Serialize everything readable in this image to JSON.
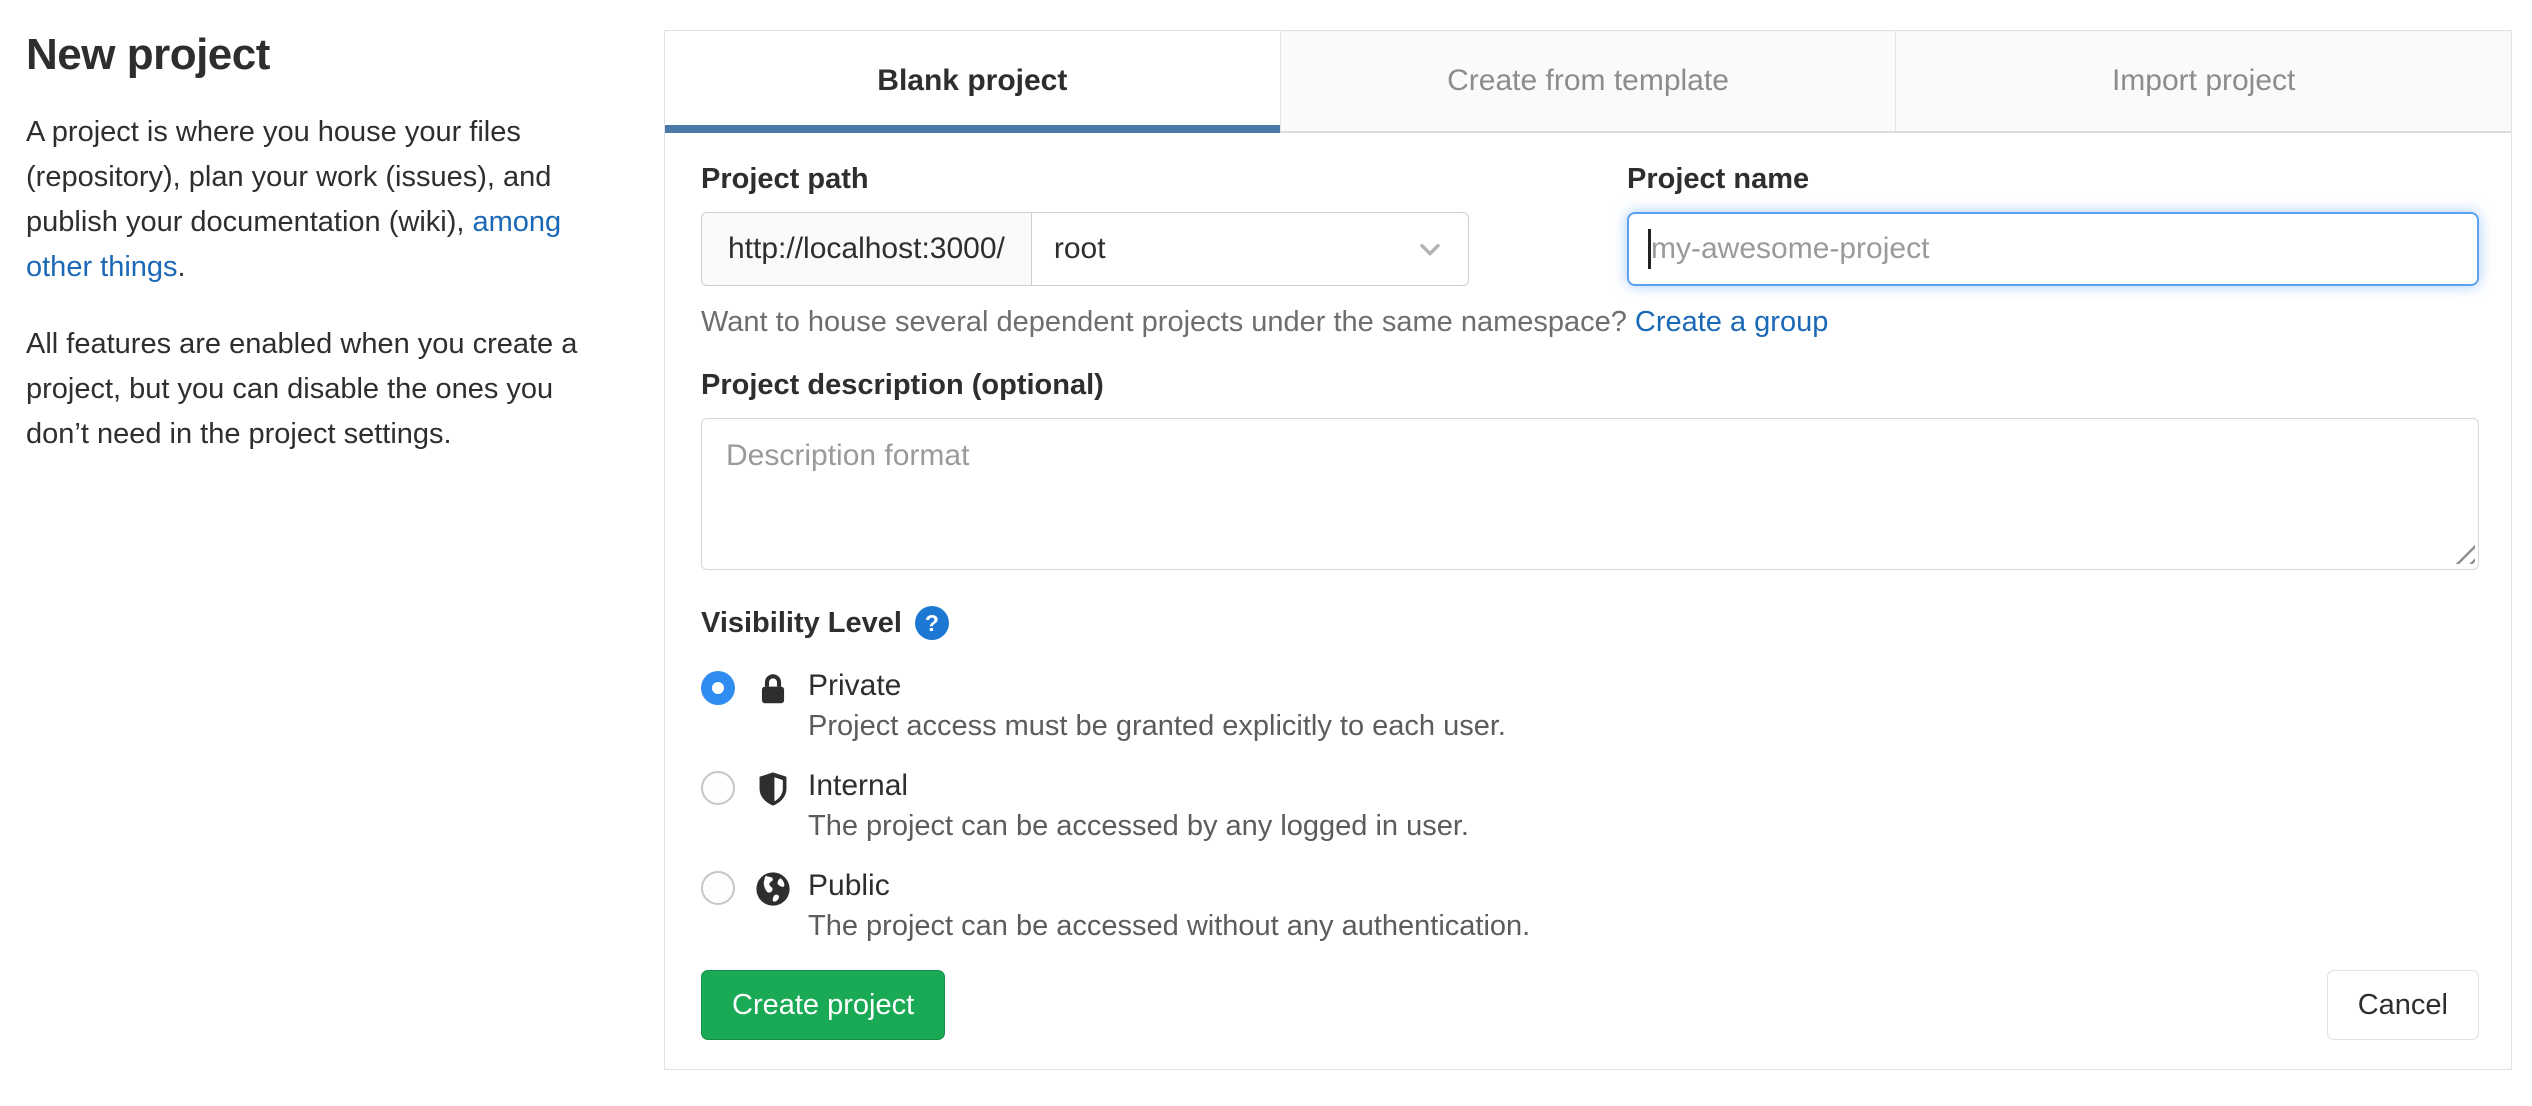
{
  "sidebar": {
    "title": "New project",
    "p1_before": "A project is where you house your files (repository), plan your work (issues), and publish your documentation (wiki), ",
    "p1_link": "among other things",
    "p1_after": ".",
    "p2": "All features are enabled when you create a project, but you can disable the ones you don’t need in the project settings."
  },
  "tabs": [
    {
      "label": "Blank project",
      "active": true
    },
    {
      "label": "Create from template",
      "active": false
    },
    {
      "label": "Import project",
      "active": false
    }
  ],
  "form": {
    "project_path": {
      "label": "Project path",
      "url_prefix": "http://localhost:3000/",
      "namespace": "root"
    },
    "project_name": {
      "label": "Project name",
      "placeholder": "my-awesome-project"
    },
    "namespace_hint": {
      "text": "Want to house several dependent projects under the same namespace?",
      "link": "Create a group"
    },
    "description": {
      "label": "Project description (optional)",
      "placeholder": "Description format"
    },
    "visibility": {
      "label": "Visibility Level",
      "help_glyph": "?",
      "options": [
        {
          "name": "Private",
          "icon": "lock-icon",
          "selected": true,
          "description": "Project access must be granted explicitly to each user."
        },
        {
          "name": "Internal",
          "icon": "shield-icon",
          "selected": false,
          "description": "The project can be accessed by any logged in user."
        },
        {
          "name": "Public",
          "icon": "globe-icon",
          "selected": false,
          "description": "The project can be accessed without any authentication."
        }
      ]
    },
    "submit_label": "Create project",
    "cancel_label": "Cancel"
  },
  "colors": {
    "link_blue": "#1b69b6",
    "radio_blue": "#2f8cf0",
    "help_blue": "#1d78d4",
    "tab_indicator_blue": "#4a79a7",
    "button_green": "#1aaa55"
  }
}
